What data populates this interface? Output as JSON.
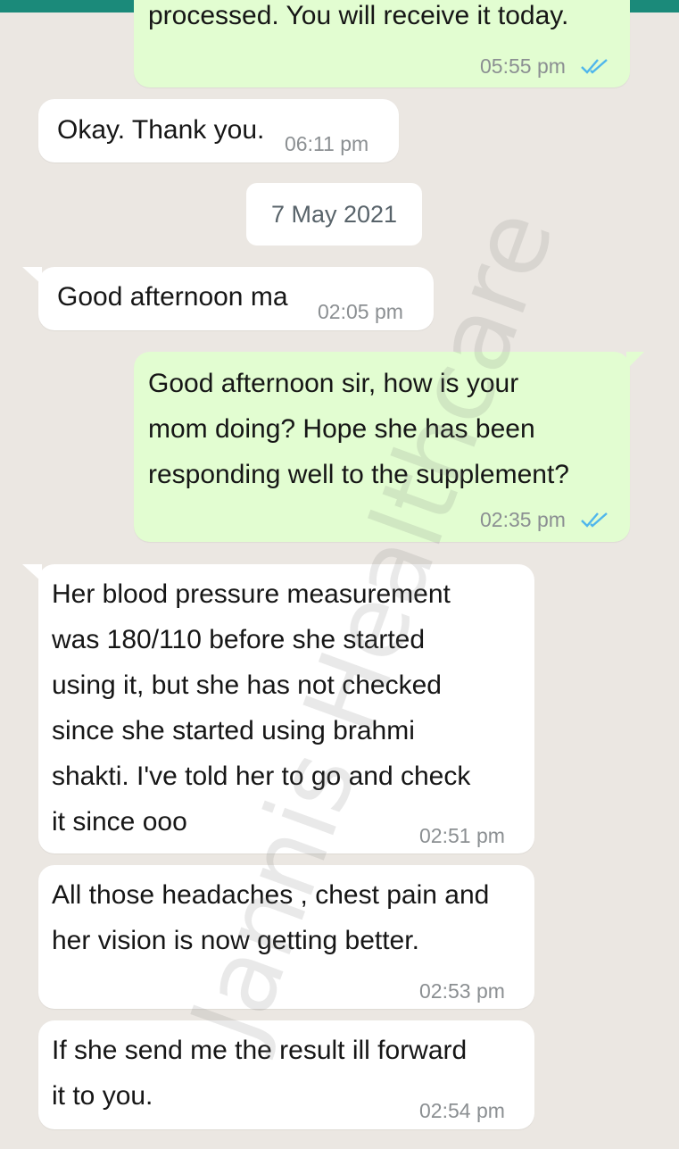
{
  "date_divider": "7 May 2021",
  "watermark": "Jannis Healthcare",
  "messages": [
    {
      "text": "processed. You will receive it today.",
      "time": "05:55 pm",
      "status": "read"
    },
    {
      "text": "Okay. Thank you.",
      "time": "06:11 pm"
    },
    {
      "text": "Good afternoon ma",
      "time": "02:05 pm"
    },
    {
      "text": "Good afternoon sir, how is your\nmom doing? Hope she has been\nresponding well to the supplement?",
      "time": "02:35 pm",
      "status": "read"
    },
    {
      "text": "Her blood pressure measurement\nwas 180/110 before she started\nusing it,  but she has not checked\nsince she started using brahmi\nshakti. I've told her to go and check\nit since ooo",
      "time": "02:51 pm"
    },
    {
      "text": "All those headaches , chest pain and\nher vision is now getting better.",
      "time": "02:53 pm"
    },
    {
      "text": "If she send me the result ill forward\nit to you.",
      "time": "02:54 pm"
    }
  ],
  "colors": {
    "read_tick": "#4fb6ec",
    "outgoing_bg": "#e2fdd1",
    "incoming_bg": "#ffffff",
    "header": "#1b8a7a"
  }
}
